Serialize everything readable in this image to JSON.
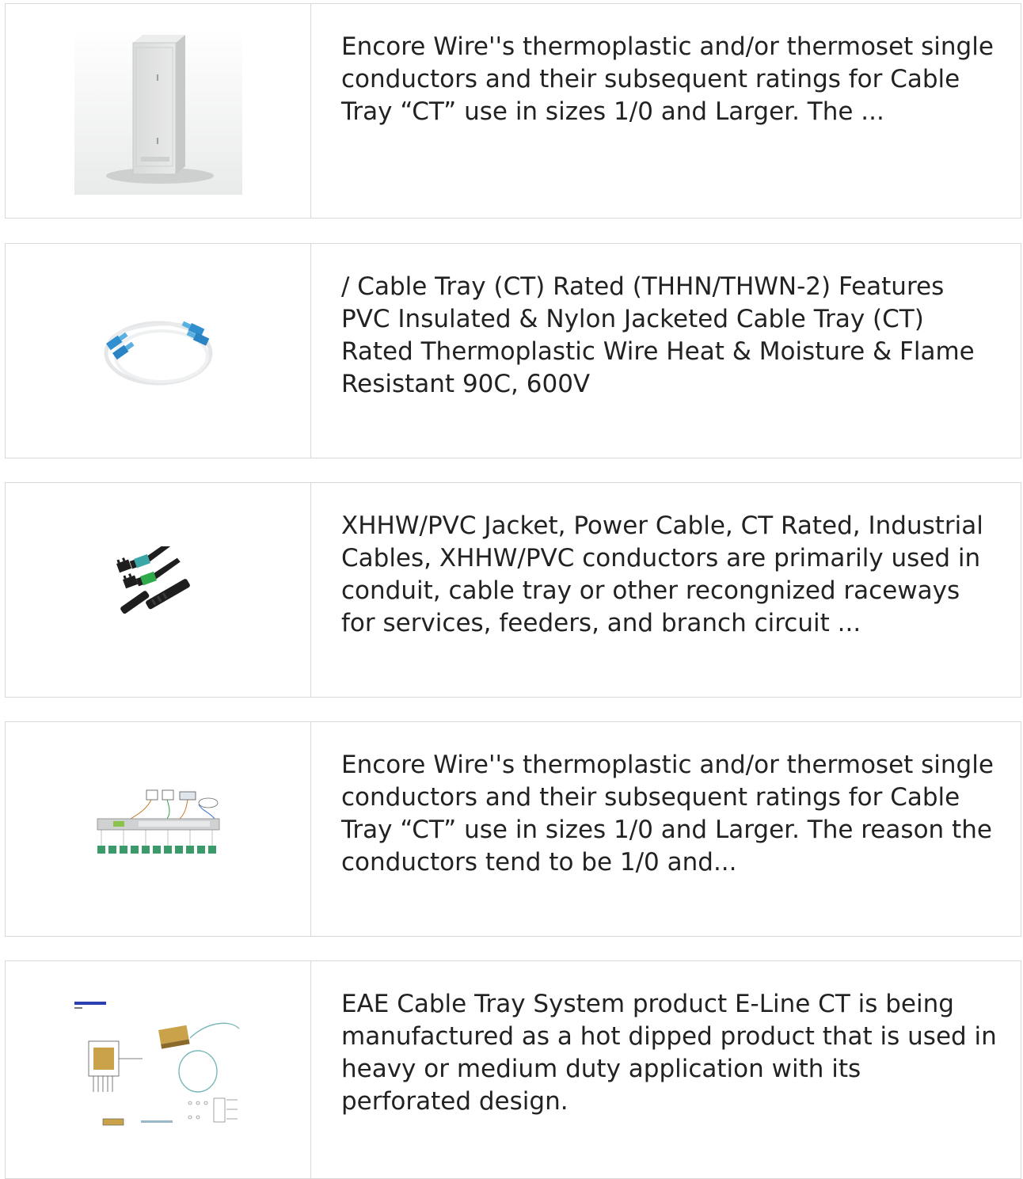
{
  "products": [
    {
      "image": "cabinet-image",
      "description": "Encore Wire''s thermoplastic and/or thermoset single conductors and their subsequent ratings for Cable Tray “CT” use in sizes 1/0 and Larger. The ..."
    },
    {
      "image": "fiber-patch-cord-image",
      "description": "/ Cable Tray (CT) Rated (THHN/THWN-2) Features PVC Insulated & Nylon Jacketed Cable Tray (CT) Rated Thermoplastic Wire Heat & Moisture & Flame Resistant 90C, 600V"
    },
    {
      "image": "mpo-connector-parts-image",
      "description": "XHHW/PVC Jacket, Power Cable, CT Rated, Industrial Cables, XHHW/PVC conductors are primarily used in conduit, cable tray or other recongnized raceways for services, feeders, and branch circuit ..."
    },
    {
      "image": "network-diagram-image",
      "description": "Encore Wire''s thermoplastic and/or thermoset single conductors and their subsequent ratings for Cable Tray “CT” use in sizes 1/0 and Larger. The reason the conductors tend to be 1/0 and..."
    },
    {
      "image": "outline-drawing-image",
      "description": "EAE Cable Tray System product E-Line CT is being manufactured as a hot dipped product that is used in heavy or medium duty application with its perforated design."
    }
  ]
}
